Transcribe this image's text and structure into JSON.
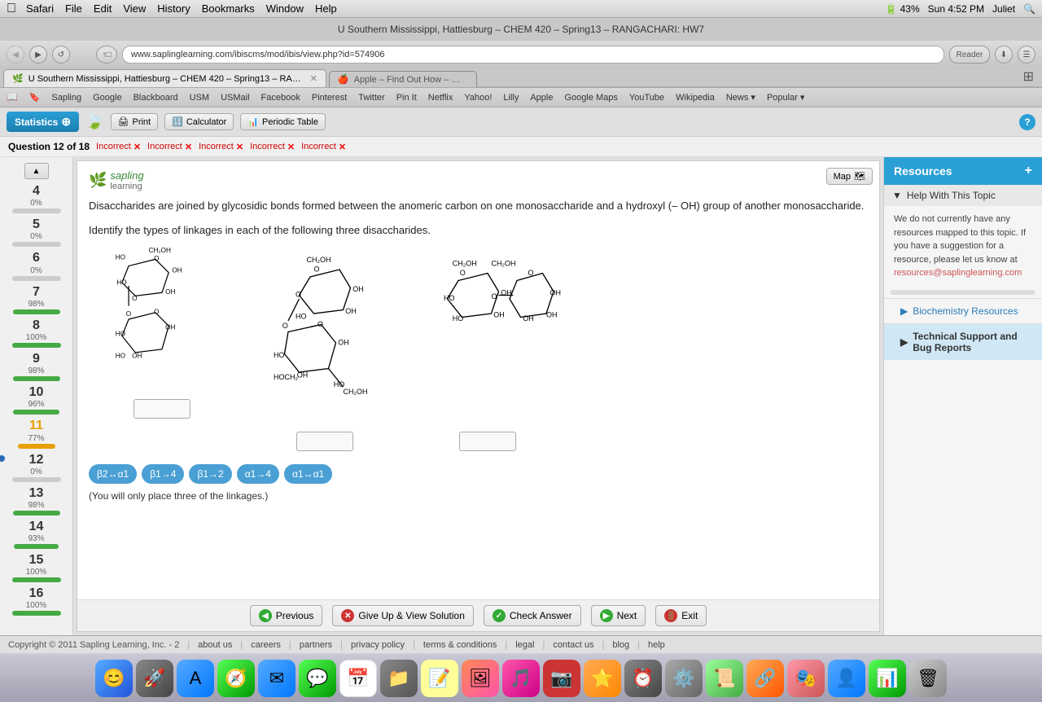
{
  "mac_menubar": {
    "apple": "&#63743;",
    "menus": [
      "Safari",
      "File",
      "Edit",
      "View",
      "History",
      "Bookmarks",
      "Window",
      "Help"
    ],
    "right": [
      "43%",
      "Sun 4:52 PM",
      "Juliet"
    ]
  },
  "browser": {
    "title": "U Southern Mississippi, Hattiesburg – CHEM 420 – Spring13 – RANGACHARI: HW7",
    "url": "www.saplinglearning.com/ibiscms/mod/ibis/view.php?id=574906",
    "tab1": "U Southern Mississippi, Hattiesburg – CHEM 420 – Spring13 – RANGACHARI: HW7",
    "tab2": "Apple – Find Out How – Mac Basics"
  },
  "bookmarks": [
    "Sapling",
    "Google",
    "Blackboard",
    "USM",
    "USMail",
    "Facebook",
    "Pinterest",
    "Twitter",
    "Pin It",
    "Netflix",
    "Yahoo!",
    "Lilly",
    "Apple",
    "Google Maps",
    "YouTube",
    "Wikipedia",
    "News ▾",
    "Popular ▾"
  ],
  "toolbar": {
    "statistics_label": "Statistics",
    "print_label": "Print",
    "calculator_label": "Calculator",
    "periodic_table_label": "Periodic Table"
  },
  "question": {
    "header": "Question 12 of 18",
    "incorrect_labels": [
      "Incorrect",
      "Incorrect",
      "Incorrect",
      "Incorrect",
      "Incorrect"
    ],
    "sapling_label": "sapling learning",
    "map_label": "Map",
    "text1": "Disaccharides are joined by glycosidic bonds formed between the anomeric carbon on one monosaccharide and a hydroxyl (– OH) group of another monosaccharide.",
    "text2": "Identify the types of linkages in each of the following three disaccharides.",
    "note": "(You will only place three of the linkages.)",
    "linkage_options": [
      "β2↔α1",
      "β1→4",
      "β1→2",
      "α1→4",
      "α1↔α1"
    ]
  },
  "resources": {
    "title": "Resources",
    "plus_icon": "+",
    "help_topic_label": "Help With This Topic",
    "help_content": "We do not currently have any resources mapped to this topic. If you have a suggestion for a resource, please let us know at",
    "help_email": "resources@saplinglearning.com",
    "biochem_label": "Biochemistry Resources",
    "tech_support_label": "Technical Support and Bug Reports"
  },
  "footer": {
    "previous_label": "Previous",
    "give_up_label": "Give Up & View Solution",
    "check_label": "Check Answer",
    "next_label": "Next",
    "exit_label": "Exit"
  },
  "status_bar": {
    "copyright": "Copyright © 2011 Sapling Learning, Inc. - 2",
    "links": [
      "about us",
      "careers",
      "partners",
      "privacy policy",
      "terms & conditions",
      "legal",
      "contact us",
      "blog",
      "help"
    ]
  },
  "q_numbers": [
    {
      "num": "4",
      "pct": "0%",
      "color": "#ccc"
    },
    {
      "num": "5",
      "pct": "0%",
      "color": "#ccc"
    },
    {
      "num": "6",
      "pct": "0%",
      "color": "#ccc"
    },
    {
      "num": "7",
      "pct": "98%",
      "color": "#4a4"
    },
    {
      "num": "8",
      "pct": "100%",
      "color": "#4a4"
    },
    {
      "num": "9",
      "pct": "98%",
      "color": "#4a4"
    },
    {
      "num": "10",
      "pct": "96%",
      "color": "#4a4"
    },
    {
      "num": "11",
      "pct": "77%",
      "color": "#e8a000"
    },
    {
      "num": "12",
      "pct": "0%",
      "color": "#ccc",
      "current": true
    },
    {
      "num": "13",
      "pct": "98%",
      "color": "#4a4"
    },
    {
      "num": "14",
      "pct": "93%",
      "color": "#4a4"
    },
    {
      "num": "15",
      "pct": "100%",
      "color": "#4a4"
    },
    {
      "num": "16",
      "pct": "100%",
      "color": "#4a4"
    }
  ]
}
